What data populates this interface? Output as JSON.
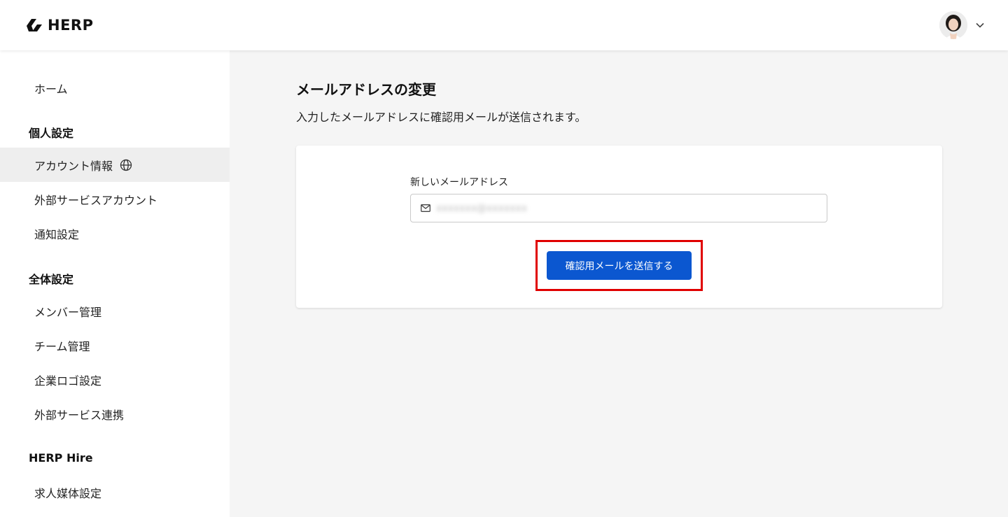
{
  "brand": {
    "name": "HERP",
    "logo_icon": "herp-logo-icon"
  },
  "header": {
    "avatar_icon": "user-avatar",
    "menu_icon": "chevron-down-icon"
  },
  "sidebar": {
    "home": "ホーム",
    "personal_heading": "個人設定",
    "personal_items": [
      "アカウント情報",
      "外部サービスアカウント",
      "通知設定"
    ],
    "global_heading": "全体設定",
    "global_items": [
      "メンバー管理",
      "チーム管理",
      "企業ロゴ設定",
      "外部サービス連携"
    ],
    "hire_heading": "HERP Hire",
    "hire_items": [
      "求人媒体設定"
    ],
    "active_item": "アカウント情報",
    "active_item_icon": "globe-icon"
  },
  "main": {
    "title": "メールアドレスの変更",
    "description": "入力したメールアドレスに確認用メールが送信されます。",
    "form": {
      "label": "新しいメールアドレス",
      "email_value": "xxxxxxx@xxxxxxx",
      "input_icon": "mail-icon",
      "submit_label": "確認用メールを送信する"
    }
  },
  "colors": {
    "primary": "#0b57d0",
    "highlight": "#e00000",
    "active_bg": "#eeeeee",
    "page_bg": "#f5f5f5"
  }
}
